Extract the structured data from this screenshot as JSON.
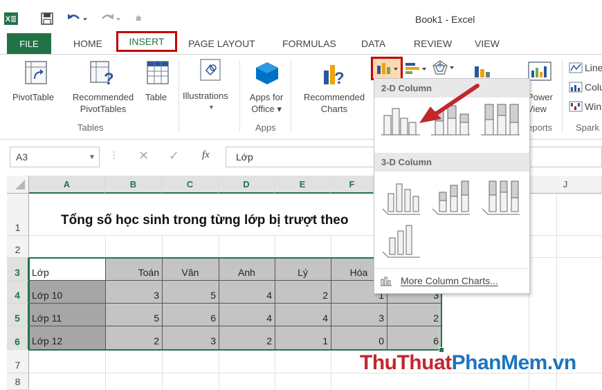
{
  "window": {
    "title": "Book1 - Excel",
    "app_logo": "X≣"
  },
  "quick_access": {
    "save_icon": "save-icon",
    "undo_icon": "undo-icon",
    "redo_icon": "redo-icon",
    "customize_icon": "customize-icon"
  },
  "tabs": [
    {
      "label": "FILE"
    },
    {
      "label": "HOME"
    },
    {
      "label": "INSERT"
    },
    {
      "label": "PAGE LAYOUT"
    },
    {
      "label": "FORMULAS"
    },
    {
      "label": "DATA"
    },
    {
      "label": "REVIEW"
    },
    {
      "label": "VIEW"
    }
  ],
  "ribbon": {
    "pivottable": "PivotTable",
    "recommended_pivottables": [
      "Recommended",
      "PivotTables"
    ],
    "table": "Table",
    "tables_group": "Tables",
    "illustrations": "Illustrations",
    "apps_for_office": [
      "Apps for",
      "Office ▾"
    ],
    "apps_group": "Apps",
    "recommended_charts": [
      "Recommended",
      "Charts"
    ],
    "power_view": [
      "Power",
      "View"
    ],
    "reports_group": "eports",
    "spark_line": "Line",
    "spark_column": "Colu",
    "spark_winloss": "Win",
    "sparklines_group": "Spark"
  },
  "formula_bar": {
    "name_box": "A3",
    "fx": "fx",
    "formula": "Lớp"
  },
  "grid": {
    "columns": [
      "A",
      "B",
      "C",
      "D",
      "E",
      "F",
      "J"
    ],
    "rows": [
      "1",
      "2",
      "3",
      "4",
      "5",
      "6",
      "7",
      "8"
    ],
    "title": "Tổng số học sinh trong từng lớp bị trượt theo",
    "header": [
      "Lớp",
      "Toán",
      "Văn",
      "Anh",
      "Lý",
      "Hóa"
    ],
    "data": [
      [
        "Lớp 10",
        "3",
        "5",
        "4",
        "2",
        "1",
        "3"
      ],
      [
        "Lớp 11",
        "5",
        "6",
        "4",
        "4",
        "3",
        "2"
      ],
      [
        "Lớp 12",
        "2",
        "3",
        "2",
        "1",
        "0",
        "6"
      ]
    ]
  },
  "dropdown": {
    "section_2d": "2-D Column",
    "section_3d": "3-D Column",
    "more": "More Column Charts..."
  },
  "watermark": {
    "part1": "ThuThuat",
    "part2": "PhanMem",
    "part3": ".vn"
  },
  "colors": {
    "excel_green": "#217346",
    "highlight_red": "#c00000",
    "selection_gray": "#c4c4c4",
    "column_a_gray": "#a6a6a6"
  }
}
